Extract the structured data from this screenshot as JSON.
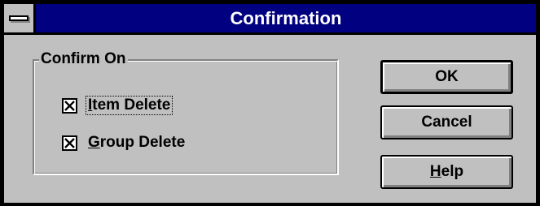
{
  "window": {
    "title": "Confirmation",
    "system_menu_icon": "system-menu-icon"
  },
  "group": {
    "label": "Confirm On",
    "options": [
      {
        "label_mnemonic": "I",
        "label_rest": "tem Delete",
        "checked": true
      },
      {
        "label_mnemonic": "G",
        "label_rest": "roup Delete",
        "checked": true
      }
    ]
  },
  "buttons": {
    "ok": "OK",
    "cancel": "Cancel",
    "help_mnemonic": "H",
    "help_rest": "elp"
  },
  "colors": {
    "titlebar": "#000080",
    "face": "#c0c0c0",
    "shadow": "#808080",
    "highlight": "#ffffff"
  }
}
